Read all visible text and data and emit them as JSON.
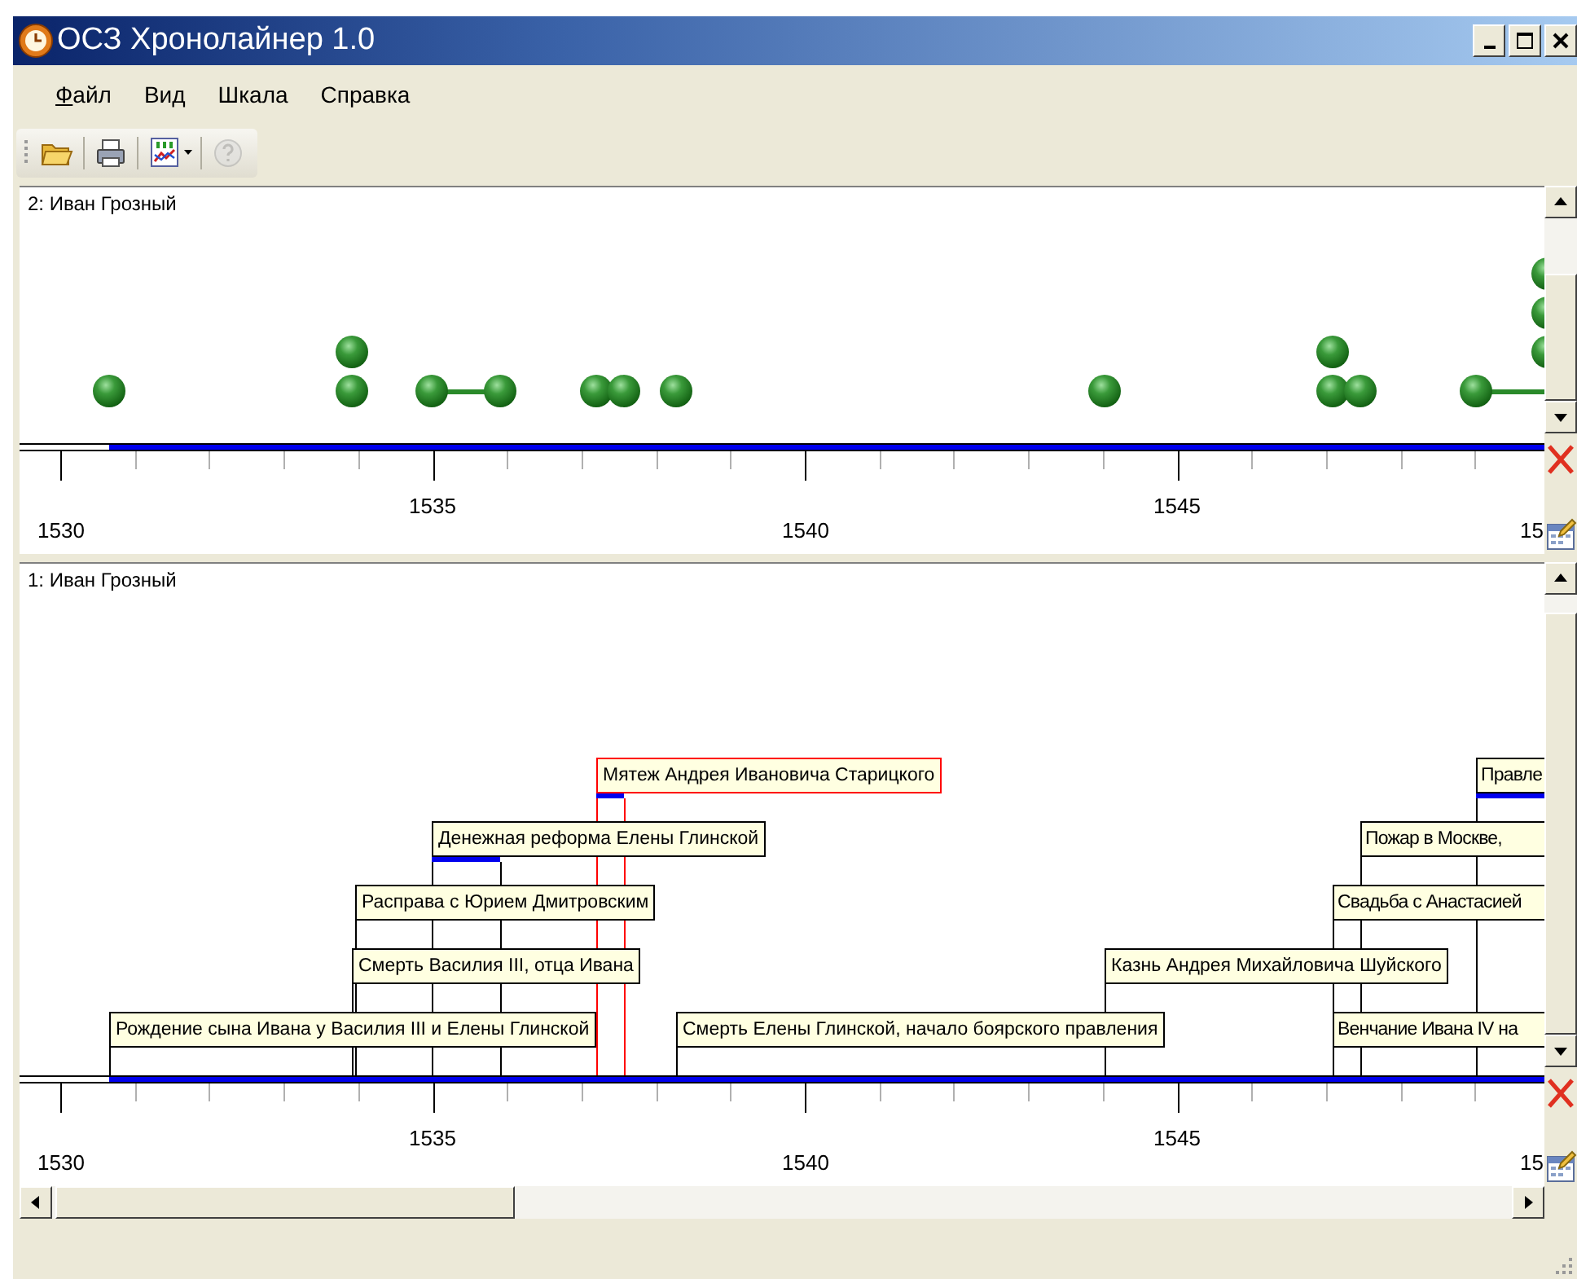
{
  "window": {
    "title": "ОСЗ Хронолайнер 1.0"
  },
  "menu": [
    {
      "label": "Файл",
      "mnemonic": true
    },
    {
      "label": "Вид",
      "mnemonic": false
    },
    {
      "label": "Шкала",
      "mnemonic": false
    },
    {
      "label": "Справка",
      "mnemonic": false
    }
  ],
  "toolbar": [
    {
      "kind": "open",
      "disabled": false
    },
    {
      "kind": "print",
      "disabled": false
    },
    {
      "kind": "chart",
      "disabled": false
    },
    {
      "kind": "help",
      "disabled": true
    }
  ],
  "panels": [
    {
      "kind": "dots",
      "title": "2: Иван Грозный",
      "ticks": [
        "1530",
        "1535",
        "1540",
        "1545",
        "15"
      ]
    },
    {
      "kind": "labels",
      "title": "1: Иван Грозный",
      "ticks": [
        "1530",
        "1535",
        "1540",
        "1545",
        "15"
      ],
      "lanes": [
        [
          {
            "label": "Мятеж Андрея Ивановича Старицкого",
            "selected": true,
            "cut": false
          },
          {
            "label": "Правле",
            "selected": false,
            "cut": true
          }
        ],
        [
          {
            "label": "Денежная реформа Елены Глинской",
            "selected": false,
            "cut": false
          },
          {
            "label": "Пожар в Москве,",
            "selected": false,
            "cut": true
          }
        ],
        [
          {
            "label": "Расправа с Юрием Дмитровским",
            "selected": false,
            "cut": false
          },
          {
            "label": "Свадьба с Анастасией",
            "selected": false,
            "cut": true
          }
        ],
        [
          {
            "label": "Смерть Василия III, отца Ивана",
            "selected": false,
            "cut": false
          },
          {
            "label": "Казнь Андрея Михайловича Шуйского",
            "selected": false,
            "cut": false
          }
        ],
        [
          {
            "label": "Рождение сына Ивана у Василия III и Елены Глинской",
            "selected": false,
            "cut": false
          },
          {
            "label": "Смерть Елены Глинской, начало боярского правления",
            "selected": false,
            "cut": false
          },
          {
            "label": "Венчание Ивана IV на",
            "selected": false,
            "cut": true
          }
        ]
      ]
    }
  ]
}
